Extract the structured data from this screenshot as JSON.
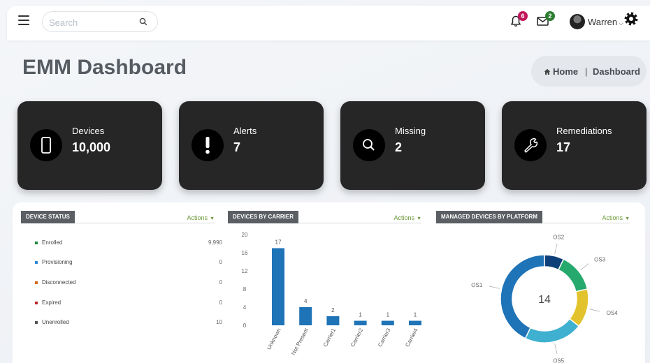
{
  "header": {
    "search_placeholder": "Search",
    "notifications_count": "6",
    "messages_count": "2",
    "user_name": "Warren"
  },
  "page": {
    "title": "EMM Dashboard",
    "breadcrumb_home": "Home",
    "breadcrumb_current": "Dashboard"
  },
  "cards": [
    {
      "label": "Devices",
      "value": "10,000",
      "icon": "phone-icon"
    },
    {
      "label": "Alerts",
      "value": "7",
      "icon": "exclamation-icon"
    },
    {
      "label": "Missing",
      "value": "2",
      "icon": "search-icon"
    },
    {
      "label": "Remediations",
      "value": "17",
      "icon": "wrench-icon"
    }
  ],
  "device_status": {
    "title": "DEVICE STATUS",
    "actions": "Actions",
    "rows": [
      {
        "name": "Enrolled",
        "value": "9,990",
        "color": "#1f8a3c"
      },
      {
        "name": "Provisioning",
        "value": "0",
        "color": "#2e8bd6"
      },
      {
        "name": "Disconnected",
        "value": "0",
        "color": "#d46b1b"
      },
      {
        "name": "Expired",
        "value": "0",
        "color": "#c1272d"
      },
      {
        "name": "Unenrolled",
        "value": "10",
        "color": "#555555"
      }
    ]
  },
  "carrier_section": {
    "title": "DEVICES BY CARRIER",
    "actions": "Actions"
  },
  "platform_section": {
    "title": "MANAGED DEVICES BY PLATFORM",
    "actions": "Actions",
    "center_label": "14"
  },
  "colors": {
    "bar": "#1f73b7",
    "card_bg": "#262626",
    "actions_green": "#6c9a3b"
  },
  "chart_data": [
    {
      "type": "bar",
      "title": "DEVICES BY CARRIER",
      "categories": [
        "Unknown",
        "Not Present",
        "Carrier1",
        "Carrier2",
        "Carrier3",
        "Carrier4"
      ],
      "values": [
        17,
        4,
        2,
        1,
        1,
        1
      ],
      "yticks": [
        0,
        4,
        8,
        12,
        16,
        20
      ],
      "ylim": [
        0,
        20
      ],
      "grid": false
    },
    {
      "type": "pie",
      "title": "MANAGED DEVICES BY PLATFORM",
      "labels": [
        "OS1",
        "OS2",
        "OS3",
        "OS4",
        "OS5"
      ],
      "values": [
        6,
        1,
        2,
        2,
        3
      ],
      "colors": [
        "#1f73b7",
        "#0d3f78",
        "#26a96c",
        "#e3c32d",
        "#3fb0cf"
      ],
      "center_value": "14",
      "donut": true
    }
  ]
}
